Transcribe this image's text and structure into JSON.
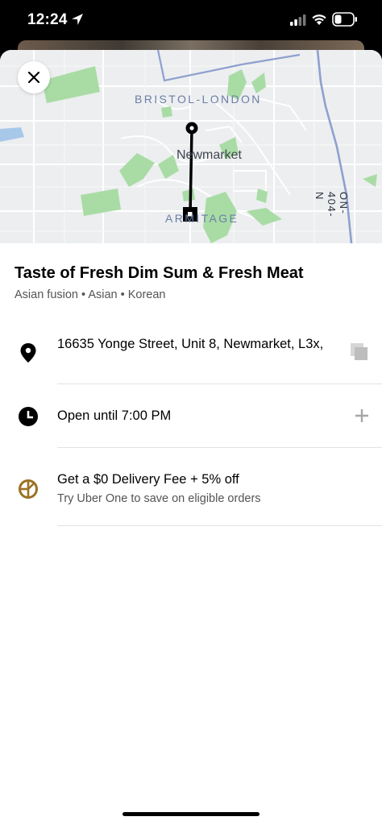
{
  "status_bar": {
    "time": "12:24"
  },
  "map": {
    "labels": {
      "area_north": "BRISTOL-LONDON",
      "city": "Newmarket",
      "area_south": "ARMITAGE",
      "highway": "ON-404-N"
    }
  },
  "store": {
    "name": "Taste of Fresh Dim Sum & Fresh Meat",
    "categories": "Asian fusion • Asian • Korean"
  },
  "address": {
    "line": "16635 Yonge Street, Unit 8, Newmarket, L3x,"
  },
  "hours": {
    "text": "Open until 7:00 PM"
  },
  "promo": {
    "title": "Get a $0 Delivery Fee + 5% off",
    "subtitle": "Try Uber One to save on eligible orders"
  },
  "colors": {
    "map_bg": "#eceef0",
    "park": "#a9dca5",
    "water": "#a8c8ea",
    "highway": "#8fa0cf",
    "uber_one": "#9b7222"
  }
}
